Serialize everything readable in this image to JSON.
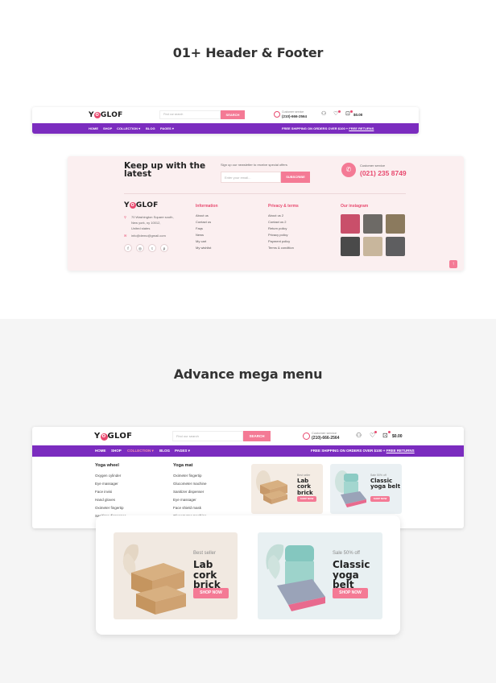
{
  "section1": {
    "title": "01+ Header & Footer"
  },
  "section2": {
    "title": "Advance mega menu"
  },
  "brand": {
    "logo_pre": "Y",
    "logo_o": "O",
    "logo_post": "GLOF"
  },
  "header": {
    "search_placeholder": "Find our search",
    "search_button": "SEARCH",
    "customer_service_label": "Customer service",
    "phone": "(210)-666-2564",
    "cart_total": "$0.00",
    "nav": [
      "HOME",
      "SHOP",
      "COLLECTION ▾",
      "BLOG",
      "PAGES ▾"
    ],
    "shipping_text": "FREE SHIPPING ON ORDERS OVER $100 + ",
    "shipping_link": "FREE RETURNS"
  },
  "footer": {
    "heading_line1": "Keep up with the",
    "heading_line2": "latest",
    "newsletter_text": "Sign up our newsletter to receive special offers",
    "email_placeholder": "Enter your email...",
    "subscribe": "SUBSCRIBE",
    "customer_service_label": "Customer service",
    "phone": "(021) 235 8749",
    "address_line1": "70 Washington Square south,",
    "address_line2": "New york, ny 10012,",
    "address_line3": "United states",
    "email": "info@demo@gmail.com",
    "social": [
      "f",
      "◎",
      "t",
      "p"
    ],
    "columns": [
      {
        "title": "Information",
        "links": [
          "About us",
          "Contact us",
          "Faqs",
          "News",
          "My cart",
          "My wishlist"
        ]
      },
      {
        "title": "Privacy & terms",
        "links": [
          "About us 2",
          "Contact us 2",
          "Return policy",
          "Privacy policy",
          "Payment policy",
          "Terms & condition"
        ]
      },
      {
        "title": "Our instagram",
        "links": []
      }
    ],
    "instagram_colors": [
      "#c94f6a",
      "#6d6a66",
      "#8b7a5e",
      "#4a4a4a",
      "#c8b69c",
      "#5e5e60"
    ],
    "back_to_top": "↑"
  },
  "mega_menu": {
    "columns": [
      {
        "title": "Yoga wheel",
        "links": [
          "Oxygen cylinder",
          "Eye massager",
          "Face invisi",
          "Hand gloves",
          "Oximeter fingertip",
          "Sanitizer dispenser"
        ]
      },
      {
        "title": "Yoga mat",
        "links": [
          "Oximeter fingertip",
          "Glucometer machine",
          "Sanitizer dispenser",
          "Eye massager",
          "Face shield mask",
          "Glucometer machine"
        ]
      }
    ],
    "promos": [
      {
        "eyebrow": "Best seller",
        "title_line1": "Lab cork",
        "title_line2": "brick",
        "button": "SHOP NOW"
      },
      {
        "eyebrow": "Sale 50% off",
        "title_line1": "Classic",
        "title_line2": "yoga belt",
        "button": "SHOP NOW"
      }
    ]
  },
  "colors": {
    "accent": "#7b2cbf",
    "pink": "#f47a95",
    "brand_pink": "#e84a6f",
    "footer_bg": "#fbeff0"
  }
}
